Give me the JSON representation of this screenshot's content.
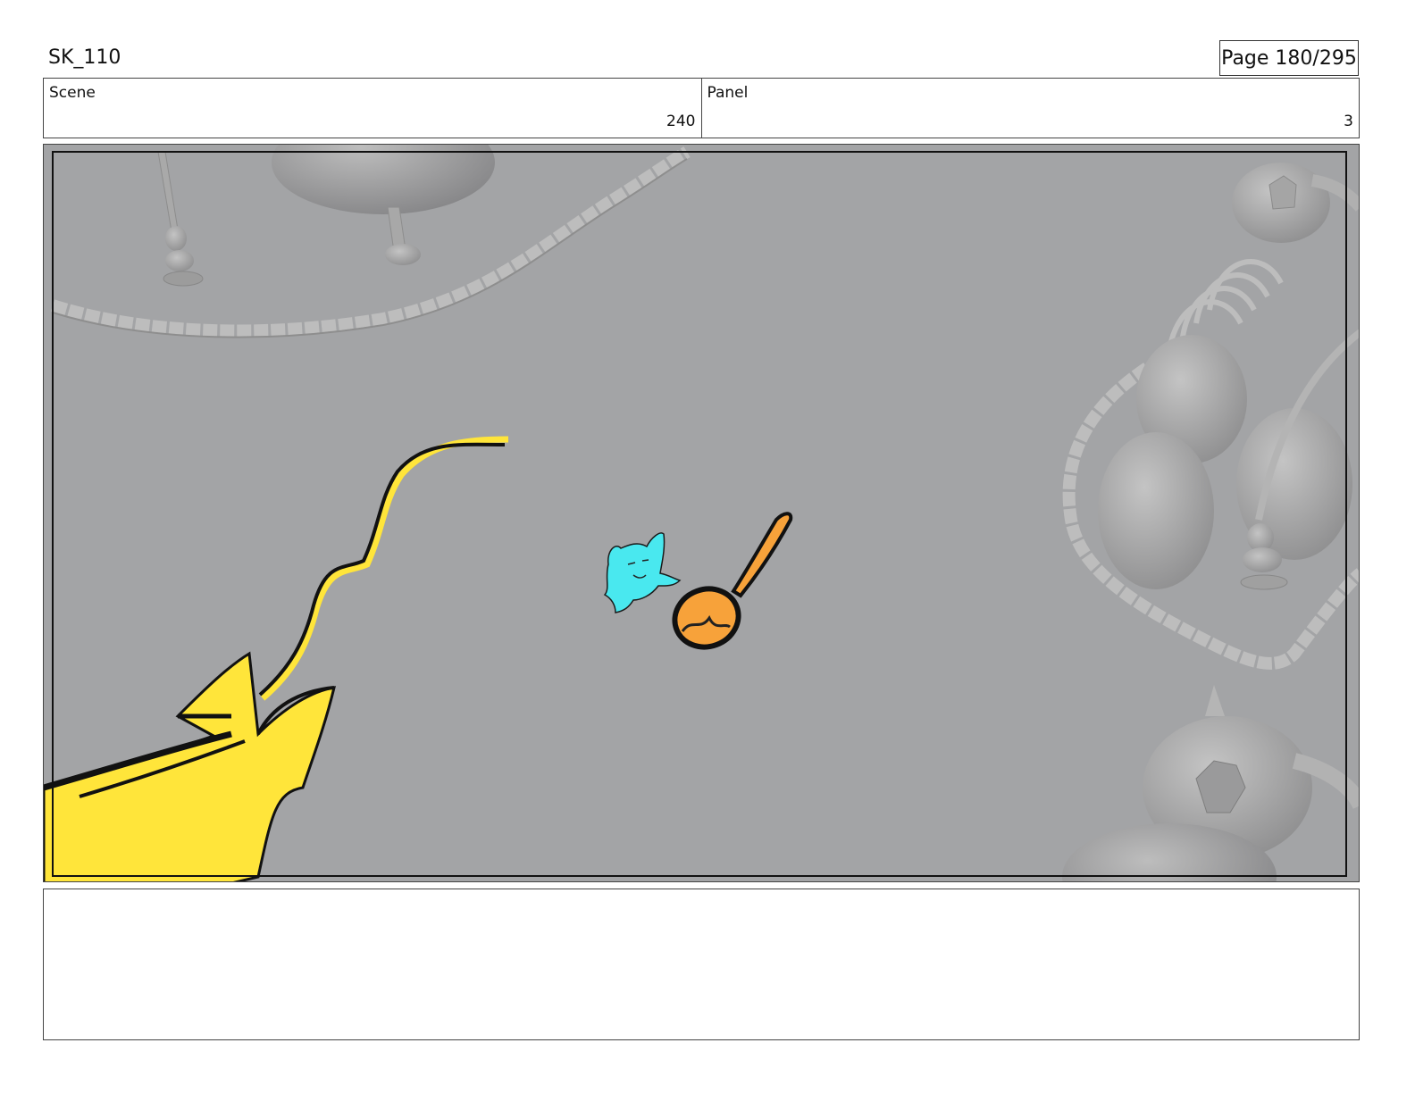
{
  "header": {
    "title": "SK_110",
    "page_label": "Page 180/295"
  },
  "info": {
    "scene_label": "Scene",
    "scene_value": "240",
    "panel_label": "Panel",
    "panel_value": "3"
  },
  "colors": {
    "ground": "#a3a4a6",
    "model_gray": "#b5b5b5",
    "sketch_yellow": "#ffe53a",
    "character_cyan": "#49e8ef",
    "ladle_orange": "#f7a23a"
  },
  "notes": {
    "text": ""
  }
}
